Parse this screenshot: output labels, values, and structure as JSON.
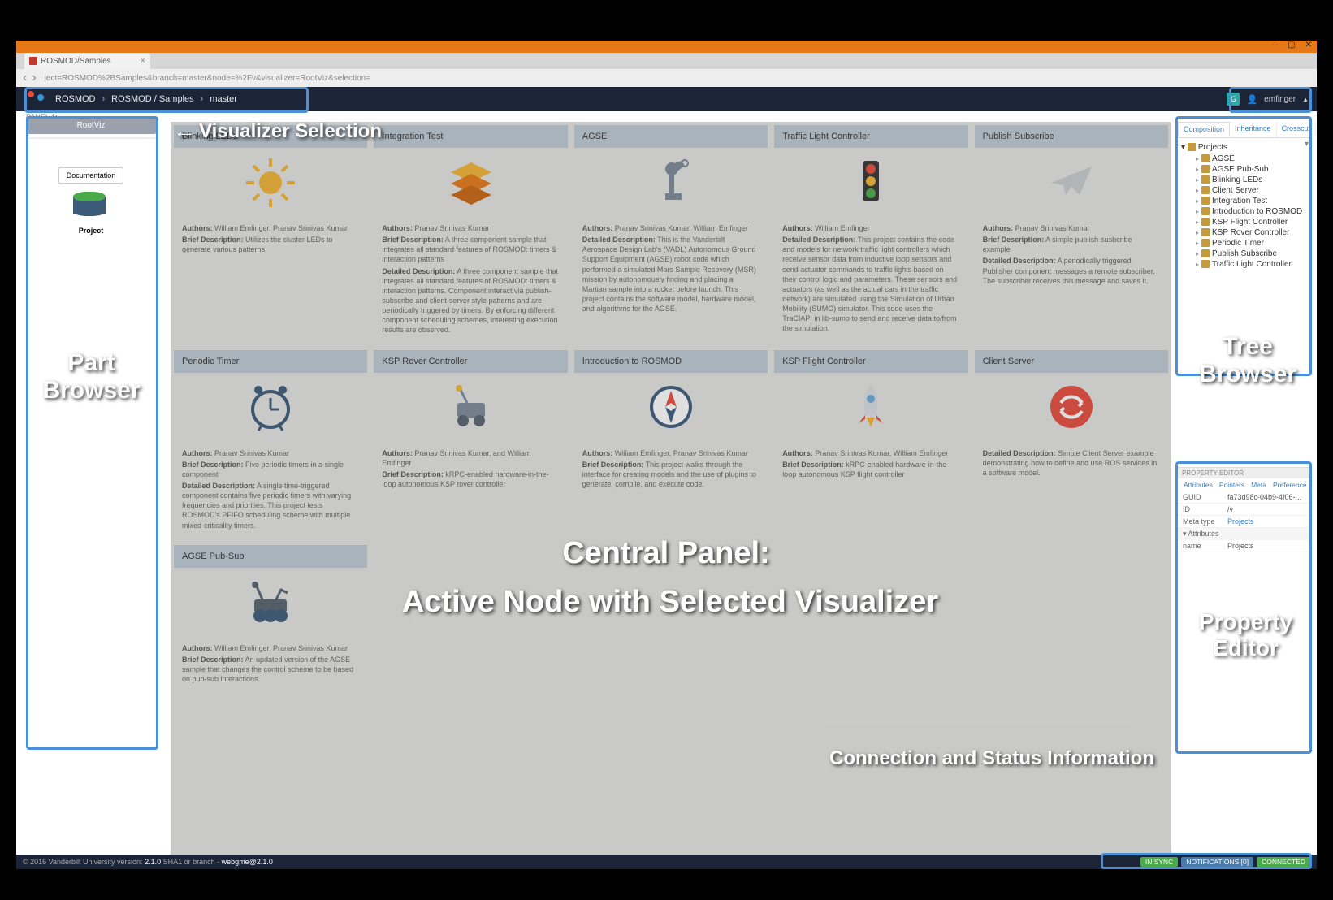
{
  "browser": {
    "tab_title": "ROSMOD/Samples",
    "url_display": "ject=ROSMOD%2BSamples&branch=master&node=%2Fv&visualizer=RootViz&selection=",
    "window_controls": [
      "–",
      "▢",
      "✕"
    ]
  },
  "nav": {
    "items": [
      "ROSMOD",
      "ROSMOD / Samples",
      "master"
    ],
    "user_initial": "G",
    "user_name": "emfinger"
  },
  "left": {
    "panel_label": "PANEL 1:",
    "visualizer": "RootViz",
    "doc_button": "Documentation",
    "project_label": "Project"
  },
  "cards": [
    {
      "title": "Blinking LEDs",
      "icon": "sun-icon",
      "authors": "William Emfinger, Pranav Srinivas Kumar",
      "brief": "Utilizes the cluster LEDs to generate various patterns.",
      "detailed": ""
    },
    {
      "title": "Integration Test",
      "icon": "layers-icon",
      "authors": "Pranav Srinivas Kumar",
      "brief": "A three component sample that integrates all standard features of ROSMOD: timers & interaction patterns",
      "detailed": "A three component sample that integrates all standard features of ROSMOD: timers & interaction patterns. Component interact via publish-subscribe and client-server style patterns and are periodically triggered by timers. By enforcing different component scheduling schemes, interesting execution results are observed."
    },
    {
      "title": "AGSE",
      "icon": "robot-arm-icon",
      "authors": "Pranav Srinivas Kumar, William Emfinger",
      "brief": "",
      "detailed": "This is the Vanderbilt Aerospace Design Lab's (VADL) Autonomous Ground Support Equipment (AGSE) robot code which performed a simulated Mars Sample Recovery (MSR) mission by autonomously finding and placing a Martian sample into a rocket before launch. This project contains the software model, hardware model, and algorithms for the AGSE."
    },
    {
      "title": "Traffic Light Controller",
      "icon": "traffic-light-icon",
      "authors": "William Emfinger",
      "brief": "",
      "detailed": "This project contains the code and models for network traffic light controllers which receive sensor data from inductive loop sensors and send actuator commands to traffic lights based on their control logic and parameters. These sensors and actuators (as well as the actual cars in the traffic network) are simulated using the Simulation of Urban Mobility (SUMO) simulator. This code uses the TraCIAPI in lib-sumo to send and receive data to/from the simulation."
    },
    {
      "title": "Publish Subscribe",
      "icon": "paper-plane-icon",
      "authors": "Pranav Srinivas Kumar",
      "brief": "A simple publish-susbcribe example",
      "detailed": "A periodically triggered Publisher component messages a remote subscriber. The subscriber receives this message and saves it."
    },
    {
      "title": "Periodic Timer",
      "icon": "clock-icon",
      "authors": "Pranav Srinivas Kumar",
      "brief": "Five periodic timers in a single component",
      "detailed": "A single time-triggered component contains five periodic timers with varying frequencies and priorities. This project tests ROSMOD's PFIFO scheduling scheme with multiple mixed-criticality timers."
    },
    {
      "title": "KSP Rover Controller",
      "icon": "rover-icon",
      "authors": "Pranav Srinivas Kumar, and William Emfinger",
      "brief": "kRPC-enabled hardware-in-the-loop autonomous KSP rover controller",
      "detailed": ""
    },
    {
      "title": "Introduction to ROSMOD",
      "icon": "compass-icon",
      "authors": "William Emfinger, Pranav Srinivas Kumar",
      "brief": "This project walks through the interface for creating models and the use of plugins to generate, compile, and execute code.",
      "detailed": ""
    },
    {
      "title": "KSP Flight Controller",
      "icon": "rocket-icon",
      "authors": "Pranav Srinivas Kumar, William Emfinger",
      "brief": "kRPC-enabled hardware-in-the-loop autonomous KSP flight controller",
      "detailed": ""
    },
    {
      "title": "Client Server",
      "icon": "swap-icon",
      "authors": "",
      "brief": "",
      "detailed": "Simple Client Server example demonstrating how to define and use ROS services in a software model."
    },
    {
      "title": "AGSE Pub-Sub",
      "icon": "rover2-icon",
      "authors": "William Emfinger, Pranav Srinivas Kumar",
      "brief": "An updated version of the AGSE sample that changes the control scheme to be based on pub-sub interactions.",
      "detailed": ""
    }
  ],
  "tree": {
    "tabs": [
      "Composition",
      "Inheritance",
      "Crosscut"
    ],
    "root": "Projects",
    "items": [
      "AGSE",
      "AGSE Pub-Sub",
      "Blinking LEDs",
      "Client Server",
      "Integration Test",
      "Introduction to ROSMOD",
      "KSP Flight Controller",
      "KSP Rover Controller",
      "Periodic Timer",
      "Publish Subscribe",
      "Traffic Light Controller"
    ]
  },
  "props": {
    "header": "PROPERTY EDITOR",
    "tabs": [
      "Attributes",
      "Pointers",
      "Meta",
      "Preference"
    ],
    "guid_label": "GUID",
    "guid_value": "fa73d98c-04b9-4f06-...",
    "id_label": "ID",
    "id_value": "/v",
    "meta_label": "Meta type",
    "meta_value": "Projects",
    "section": "Attributes",
    "name_label": "name",
    "name_value": "Projects"
  },
  "status": {
    "copyright": "© 2016 Vanderbilt University",
    "version_label": "version:",
    "version": "2.1.0",
    "sha_label": "SHA1 or branch -",
    "webgme": "webgme@2.1.0",
    "badges": [
      "IN SYNC",
      "NOTIFICATIONS [0]",
      "CONNECTED"
    ]
  },
  "annotations": {
    "viz_sel": "Visualizer Selection",
    "part_browser": "Part Browser",
    "tree_browser": "Tree Browser",
    "prop_editor": "Property Editor",
    "central_1": "Central Panel:",
    "central_2": "Active Node with Selected Visualizer",
    "conn_status": "Connection and Status Information"
  }
}
